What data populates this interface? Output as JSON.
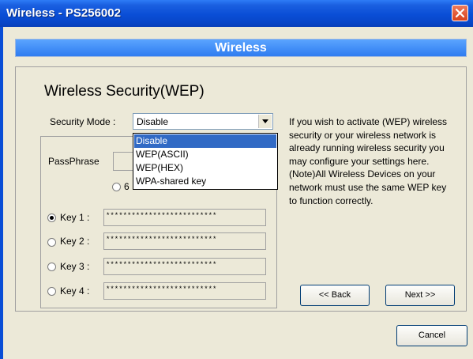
{
  "window": {
    "title": "Wireless - PS256002"
  },
  "banner": {
    "title": "Wireless"
  },
  "section": {
    "heading": "Wireless Security(WEP)"
  },
  "security_mode": {
    "label": "Security Mode :",
    "selected": "Disable",
    "options": [
      "Disable",
      "WEP(ASCII)",
      "WEP(HEX)",
      "WPA-shared key"
    ]
  },
  "passphrase": {
    "label": "PassPhrase",
    "partial_label": "6"
  },
  "keys": [
    {
      "label": "Key 1 :",
      "value": "**************************",
      "selected": true
    },
    {
      "label": "Key 2 :",
      "value": "**************************",
      "selected": false
    },
    {
      "label": "Key 3 :",
      "value": "**************************",
      "selected": false
    },
    {
      "label": "Key 4 :",
      "value": "**************************",
      "selected": false
    }
  ],
  "help_text": "If you wish to activate (WEP) wireless security or your wireless network is already running wireless security you may configure your settings here. (Note)All Wireless Devices on your network must use the same WEP key to function correctly.",
  "buttons": {
    "back": "<< Back",
    "next": "Next >>",
    "cancel": "Cancel"
  },
  "colors": {
    "titlebar": "#0a4ed6",
    "banner": "#3d8af7",
    "selection": "#316ac5",
    "close": "#e0522c"
  }
}
